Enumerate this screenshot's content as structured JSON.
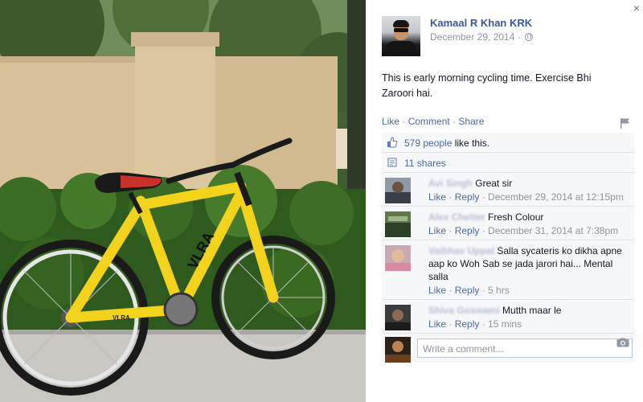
{
  "post": {
    "author_name": "Kamaal R Khan KRK",
    "date": "December 29, 2014 ·",
    "text": "This is early morning cycling time. Exercise Bhi Zaroori hai.",
    "actions": {
      "like": "Like",
      "comment": "Comment",
      "share": "Share",
      "separator": "·"
    },
    "close_label": "×"
  },
  "ufi": {
    "likes_link": "579 people",
    "likes_suffix": " like this.",
    "shares": "11 shares"
  },
  "comments": [
    {
      "name": "Avi Singh",
      "text": "Great sir",
      "like": "Like",
      "reply": "Reply",
      "time": "December 29, 2014 at 12:15pm"
    },
    {
      "name": "Alex Chetter",
      "text": "Fresh Colour",
      "like": "Like",
      "reply": "Reply",
      "time": "December 31, 2014 at 7:38pm"
    },
    {
      "name": "Vaibhav Uppal",
      "text": "Salla sycateris ko dikha apne aap ko Woh Sab se jada jarori hai... Mental salla",
      "like": "Like",
      "reply": "Reply",
      "time": "5 hrs"
    },
    {
      "name": "Shiva Goswami",
      "text": "Mutth maar le",
      "like": "Like",
      "reply": "Reply",
      "time": "15 mins"
    }
  ],
  "composer": {
    "placeholder": "Write a comment..."
  },
  "photo": {
    "frame_text_1": "VLRA",
    "frame_text_2": "VLRA"
  }
}
